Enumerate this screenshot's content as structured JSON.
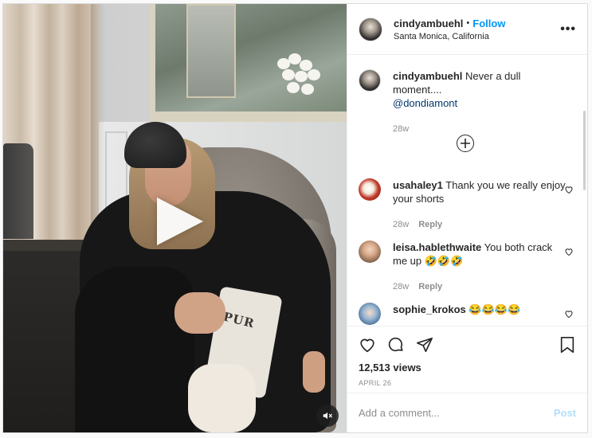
{
  "post": {
    "username": "cindyambuehl",
    "separator": "•",
    "follow_label": "Follow",
    "location": "Santa Monica, California",
    "more_icon": "more-options-icon",
    "more_glyph": "•••"
  },
  "media": {
    "type": "video",
    "pillow_text": "PUR"
  },
  "caption": {
    "username": "cindyambuehl",
    "text": "Never a dull moment....",
    "mention": "@dondiamont",
    "age": "28w"
  },
  "comments": [
    {
      "username": "usahaley1",
      "text": "Thank you we really enjoy your shorts",
      "age": "28w",
      "reply_label": "Reply"
    },
    {
      "username": "leisa.hablethwaite",
      "text": "You both crack me up 🤣🤣🤣",
      "age": "28w",
      "reply_label": "Reply"
    },
    {
      "username": "sophie_krokos",
      "text": "😂😂😂😂",
      "age": "",
      "reply_label": ""
    }
  ],
  "stats": {
    "views": "12,513 views",
    "date": "APRIL 26"
  },
  "composer": {
    "placeholder": "Add a comment...",
    "post_label": "Post"
  },
  "colors": {
    "link": "#0095f6",
    "mention": "#00376b",
    "post_disabled": "#b2dffc",
    "muted": "#8e8e8e"
  }
}
